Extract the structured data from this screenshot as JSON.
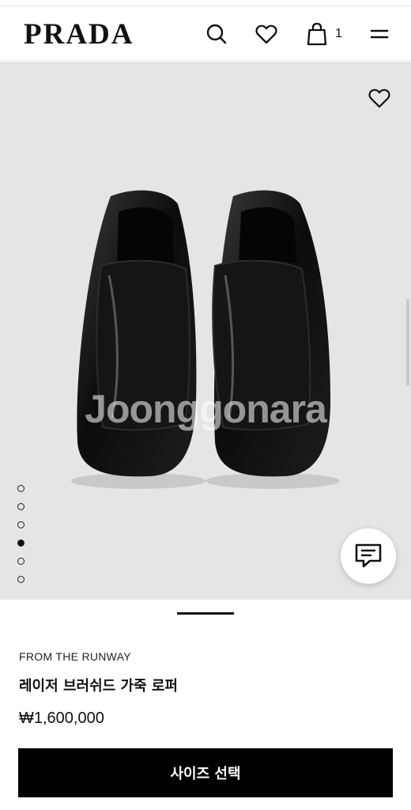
{
  "header": {
    "logo": "PRADA",
    "cart_count": "1",
    "icons": [
      "search-icon",
      "heart-icon",
      "shopping-bag-icon",
      "menu-icon"
    ]
  },
  "hero": {
    "watermark": "Joonggonara",
    "carousel": {
      "total": 6,
      "active_index": 3
    },
    "icons": [
      "heart-icon",
      "chat-icon"
    ],
    "background": "#e5e5e7"
  },
  "product": {
    "eyebrow": "FROM THE RUNWAY",
    "title": "레이저 브러쉬드 가죽 로퍼",
    "price": "₩1,600,000"
  },
  "cta": {
    "label": "사이즈 선택",
    "color": "#000000"
  }
}
